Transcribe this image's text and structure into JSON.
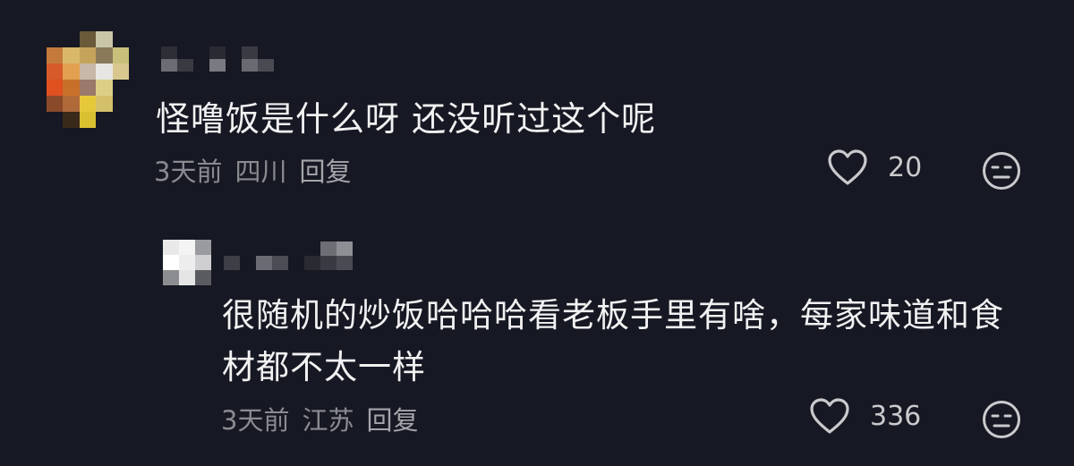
{
  "comments": [
    {
      "text": "怪噜饭是什么呀 还没听过这个呢",
      "time": "3天前",
      "location": "四川",
      "reply_label": "回复",
      "likes": "20"
    },
    {
      "text": "很随机的炒饭哈哈哈看老板手里有啥，每家味道和食材都不太一样",
      "time": "3天前",
      "location": "江苏",
      "reply_label": "回复",
      "likes": "336"
    }
  ],
  "icons": {
    "like": "heart-icon",
    "dislike": "meh-face-icon"
  },
  "colors": {
    "background": "#161823",
    "text": "#f1f1f2",
    "meta": "#8a8b91",
    "icon": "#c9cacd"
  }
}
